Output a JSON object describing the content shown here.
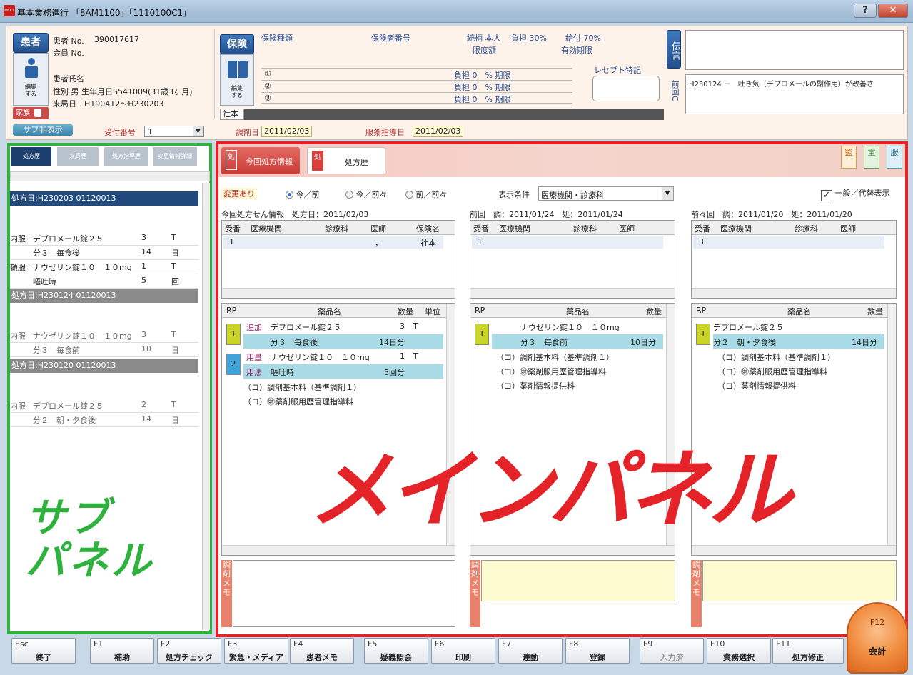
{
  "window": {
    "title": "基本業務進行 「8AM1100」「1110100C1」",
    "help": "?",
    "close": "✕",
    "logo_text": "NEXT"
  },
  "patient": {
    "section_label": "患者",
    "edit_label": "編集\nする",
    "patient_no_label": "患者 No.",
    "patient_no": "390017617",
    "member_no_label": "会員 No.",
    "name_label": "患者氏名",
    "sex_line": "性別 男 生年月日S541009(31歳3ヶ月)",
    "visit_line": "来局日　H190412～H230203",
    "family_label": "家族",
    "sub_toggle": "サブ非表示",
    "reception_label": "受付番号",
    "reception_value": "1",
    "dispense_date_label": "調剤日",
    "dispense_date": "2011/02/03",
    "guidance_date_label": "服薬指導日",
    "guidance_date": "2011/02/03"
  },
  "insurance": {
    "section_label": "保険",
    "edit_label": "編集\nする",
    "type_label": "保険種類",
    "number_label": "保険者番号",
    "relation": "続柄 本人",
    "burden": "負担 30%",
    "benefit": "給付 70%",
    "limit_label": "限度額",
    "valid_label": "有効期限",
    "rows": [
      {
        "no": "①",
        "text": "負担 0　% 期限"
      },
      {
        "no": "②",
        "text": "負担 0　% 期限"
      },
      {
        "no": "③",
        "text": "負担 0　% 期限"
      }
    ],
    "receipt_label": "レセプト特記",
    "tab": "社本"
  },
  "message": {
    "label": "伝言",
    "prev_label": "前回C",
    "prev_text": "H230124 －　吐き気（デプロメールの副作用）が改善さ"
  },
  "subpanel": {
    "tabs": [
      "処方歴",
      "来局歴",
      "処方指導歴",
      "変更情報詳細"
    ],
    "overlay_text": [
      "サブ",
      "パネル"
    ],
    "blocks": [
      {
        "header": "処方日:H230203 01120013",
        "rows": [
          [
            "内服",
            "デプロメール錠２５",
            "3",
            "T"
          ],
          [
            "",
            "分３　毎食後",
            "14",
            "日"
          ],
          [
            "頓服",
            "ナウゼリン錠１０　１０mg",
            "1",
            "T"
          ],
          [
            "",
            "嘔吐時",
            "5",
            "回"
          ]
        ]
      },
      {
        "header": "処方日:H230124 01120013",
        "rows": [
          [
            "内服",
            "ナウゼリン錠１０　１０mg",
            "3",
            "T"
          ],
          [
            "",
            "分３　毎食前",
            "10",
            "日"
          ]
        ]
      },
      {
        "header": "処方日:H230120 01120013",
        "rows": [
          [
            "内服",
            "デプロメール錠２５",
            "2",
            "T"
          ],
          [
            "",
            "分２　朝・夕食後",
            "14",
            "日"
          ]
        ]
      }
    ]
  },
  "main": {
    "tabs": [
      {
        "label": "今回処方情報",
        "icon": "処"
      },
      {
        "label": "処方歴",
        "icon": "処"
      }
    ],
    "corner_icons": [
      "監",
      "重",
      "服"
    ],
    "changed": "変更あり",
    "radios": [
      "今／前",
      "今／前々",
      "前／前々"
    ],
    "filter_label": "表示条件",
    "filter_value": "医療機関・診療科",
    "generic_label": "一般／代替表示",
    "overlay_text": "メインパネル",
    "columns": [
      {
        "title": "今回処方せん情報　処方日：2011/02/03",
        "heads": [
          "受番",
          "医療機関",
          "診療科",
          "医師",
          "保険名"
        ],
        "row": [
          "1",
          "",
          "",
          "，",
          "社本"
        ],
        "drug_heads": [
          "RP",
          "薬品名",
          "数量",
          "単位"
        ],
        "groups": [
          {
            "rp": "1",
            "color": "#c9d424",
            "lines": [
              {
                "tag": "追加",
                "name": "デプロメール錠２５",
                "qty": "3",
                "unit": "T",
                "hl": false
              },
              {
                "tag": "",
                "name": "分３　毎食後",
                "qty": "14日分",
                "unit": "",
                "hl": true
              }
            ]
          },
          {
            "rp": "2",
            "color": "#3fa3dc",
            "lines": [
              {
                "tag": "用量",
                "name": "ナウゼリン錠１０　１０mg",
                "qty": "1",
                "unit": "T",
                "hl": false
              },
              {
                "tag": "用法",
                "name": "嘔吐時",
                "qty": "5回分",
                "unit": "",
                "hl": true
              }
            ]
          }
        ],
        "extra": [
          "（コ）調剤基本料（基準調剤１）",
          "（コ）㊖薬剤服用歴管理指導料"
        ]
      },
      {
        "title": "前回　調：2011/01/24　処：2011/01/24",
        "heads": [
          "受番",
          "医療機関",
          "診療科",
          "医師"
        ],
        "row": [
          "1",
          "",
          "",
          ""
        ],
        "drug_heads": [
          "RP",
          "薬品名",
          "数量"
        ],
        "groups": [
          {
            "rp": "1",
            "color": "#c9d424",
            "lines": [
              {
                "tag": "",
                "name": "ナウゼリン錠１０　１０mg",
                "qty": "",
                "unit": "",
                "hl": false
              },
              {
                "tag": "",
                "name": "分３　毎食前",
                "qty": "10日分",
                "unit": "",
                "hl": true
              }
            ]
          }
        ],
        "extra": [
          "（コ）調剤基本料（基準調剤１）",
          "（コ）㊖薬剤服用歴管理指導料",
          "（コ）薬剤情報提供料"
        ]
      },
      {
        "title": "前々回　調：2011/01/20　処：2011/01/20",
        "heads": [
          "受番",
          "医療機関",
          "診療科",
          "医師"
        ],
        "row": [
          "3",
          "",
          "",
          ""
        ],
        "drug_heads": [
          "RP",
          "薬品名",
          "数量"
        ],
        "groups": [
          {
            "rp": "1",
            "color": "#c9d424",
            "lines": [
              {
                "tag": "",
                "name": "デプロメール錠２５",
                "qty": "",
                "unit": "",
                "hl": false
              },
              {
                "tag": "",
                "name": "分２　朝・夕食後",
                "qty": "14日分",
                "unit": "",
                "hl": true
              }
            ]
          }
        ],
        "extra": [
          "（コ）調剤基本料（基準調剤１）",
          "（コ）㊖薬剤服用歴管理指導料",
          "（コ）薬剤情報提供料"
        ]
      }
    ],
    "memo_label": "調剤メモ"
  },
  "fkeys": [
    {
      "key": "Esc",
      "label": "終了"
    },
    {
      "key": "F1",
      "label": "補助"
    },
    {
      "key": "F2",
      "label": "処方チェック"
    },
    {
      "key": "F3",
      "label": "緊急・メディア"
    },
    {
      "key": "F4",
      "label": "患者メモ"
    },
    {
      "key": "F5",
      "label": "疑義照会"
    },
    {
      "key": "F6",
      "label": "印刷"
    },
    {
      "key": "F7",
      "label": "連動"
    },
    {
      "key": "F8",
      "label": "登録"
    },
    {
      "key": "F9",
      "label": "入力済"
    },
    {
      "key": "F10",
      "label": "業務選択"
    },
    {
      "key": "F11",
      "label": "処方修正"
    }
  ],
  "f12": {
    "key": "F12",
    "label": "会計"
  },
  "colors": {
    "sub_border": "#2fb13e",
    "main_border": "#e32327",
    "accent_orange": "#f08a3c"
  }
}
